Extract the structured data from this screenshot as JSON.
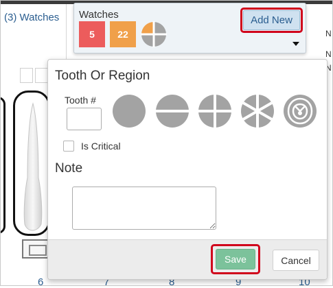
{
  "header": {
    "watches_link": "(3) Watches",
    "right_labels": [
      "N",
      "N",
      "N"
    ]
  },
  "watches_popup": {
    "title": "Watches",
    "badges": [
      {
        "label": "5",
        "color": "#ec5c5c"
      },
      {
        "label": "22",
        "color": "#f0a04a"
      }
    ],
    "add_new_label": "Add New",
    "dropdown_icon": "caret-down-icon"
  },
  "tooth_popup": {
    "heading": "Tooth Or Region",
    "tooth_label": "Tooth #",
    "tooth_value": "",
    "regions": [
      {
        "icon": "full-circle-icon"
      },
      {
        "icon": "half-circle-icon"
      },
      {
        "icon": "quadrant-circle-icon"
      },
      {
        "icon": "sextant-circle-icon"
      },
      {
        "icon": "arch-icon"
      }
    ],
    "is_critical_label": "Is Critical",
    "is_critical_checked": false,
    "note_heading": "Note",
    "note_value": "",
    "save_label": "Save",
    "cancel_label": "Cancel"
  },
  "tooth_numbers": [
    "6",
    "7",
    "8",
    "9",
    "10"
  ],
  "colors": {
    "region_gray": "#a3a3a3",
    "save_green": "#7cc29b",
    "highlight_red": "#d0021b",
    "link_blue": "#2a5d8f"
  }
}
